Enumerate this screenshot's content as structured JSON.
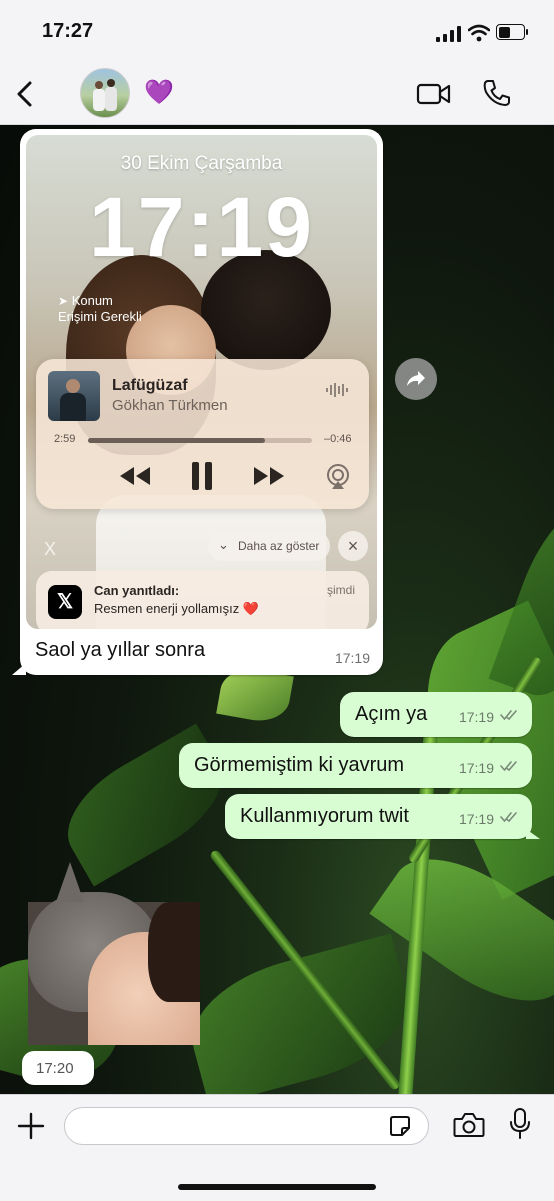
{
  "status_bar": {
    "time": "17:27"
  },
  "header": {
    "contact_emoji": "💜"
  },
  "screenshot_message": {
    "lock_date": "30 Ekim Çarşamba",
    "lock_time": "17:19",
    "location_notice_line1": "Konum",
    "location_notice_line2": "Erişimi Gerekli",
    "player": {
      "song": "Lafügüzaf",
      "artist": "Gökhan Türkmen",
      "elapsed": "2:59",
      "remaining": "–0:46",
      "progress_fraction": 0.79
    },
    "show_less_label": "Daha az göster",
    "notification": {
      "title": "Can yanıtladı:",
      "body": "Resmen enerji yollamışız ❤️",
      "time": "şimdi"
    },
    "caption": "Saol ya yıllar sonra",
    "time": "17:19"
  },
  "outgoing_messages": [
    {
      "text": "Açım ya",
      "time": "17:19"
    },
    {
      "text": "Görmemiştim ki yavrum",
      "time": "17:19"
    },
    {
      "text": "Kullanmıyorum twit",
      "time": "17:19"
    }
  ],
  "sticker_message": {
    "time": "17:20"
  }
}
